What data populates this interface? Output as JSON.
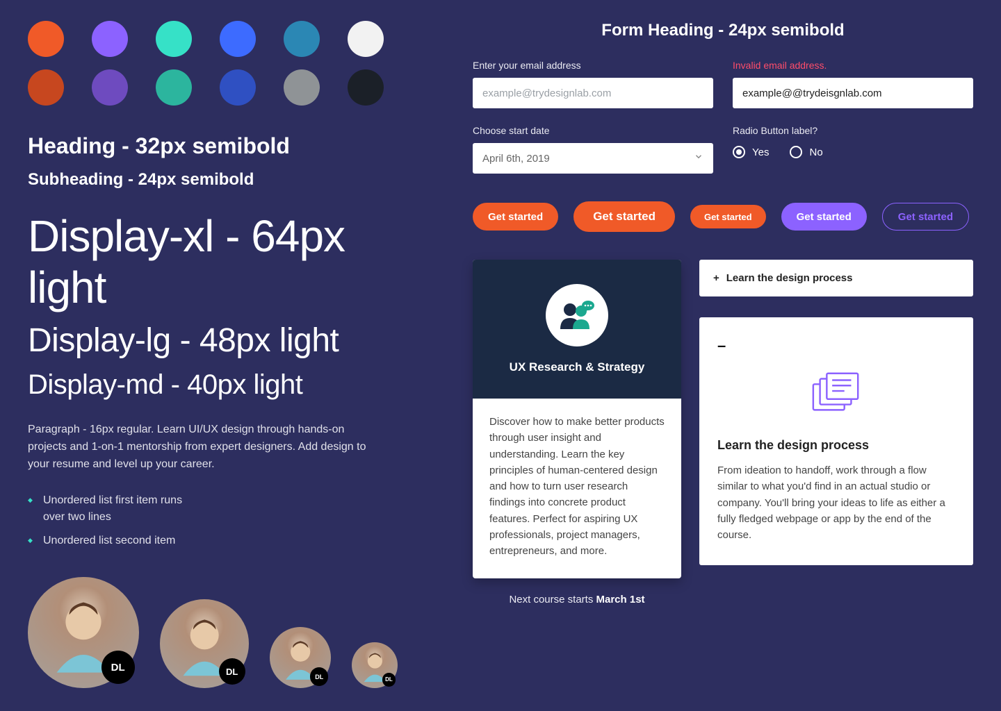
{
  "colors": {
    "row1": [
      "#f05a28",
      "#8c62ff",
      "#36e1c7",
      "#3d6bff",
      "#2b87b4",
      "#f2f2f2"
    ],
    "row2": [
      "#c7471f",
      "#6e4bbf",
      "#2cb59e",
      "#2f50c2",
      "#8f9396",
      "#1b2028"
    ]
  },
  "typography": {
    "heading": "Heading - 32px semibold",
    "subheading": "Subheading - 24px semibold",
    "display_xl": "Display-xl - 64px light",
    "display_lg": "Display-lg - 48px light",
    "display_md": "Display-md - 40px light",
    "paragraph": "Paragraph - 16px regular. Learn UI/UX design through hands-on projects and 1-on-1 mentorship from expert designers. Add design to your resume and level up your career.",
    "list_items": [
      "Unordered list first item runs over two lines",
      "Unordered list second item"
    ]
  },
  "avatars": {
    "badge_text": "DL"
  },
  "form": {
    "heading": "Form Heading - 24px semibold",
    "email_label": "Enter your email address",
    "email_placeholder": "example@trydesignlab.com",
    "invalid_label": "Invalid email address.",
    "invalid_value": "example@@trydeisgnlab.com",
    "date_label": "Choose start date",
    "date_value": "April 6th, 2019",
    "radio_label": "Radio Button label?",
    "radio_yes": "Yes",
    "radio_no": "No"
  },
  "buttons": {
    "label": "Get started"
  },
  "course_card": {
    "title": "UX Research & Strategy",
    "body": "Discover how to make better products through user insight and understanding. Learn the key principles of human-centered design and how to turn user research findings into concrete product features. Perfect for aspiring UX professionals, project managers, entrepreneurs, and more.",
    "next_course_prefix": "Next course starts ",
    "next_course_date": "March 1st"
  },
  "accordion": {
    "closed_title": "Learn the design process",
    "open_title": "Learn the design process",
    "open_body": "From ideation to handoff, work through a flow similar to what you'd find in an actual studio or company. You'll bring your ideas to life as either a fully fledged webpage or app by the end of the course."
  }
}
